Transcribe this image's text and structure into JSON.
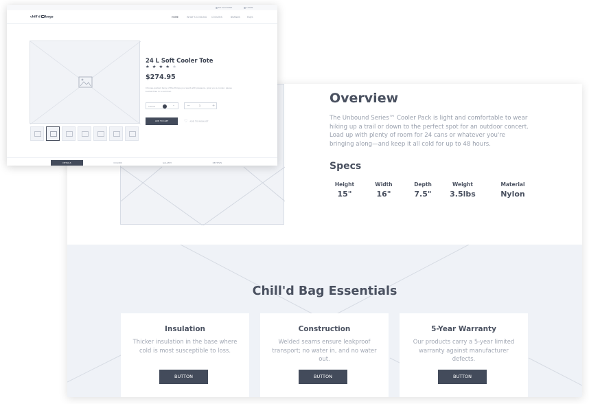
{
  "front": {
    "utility": {
      "account": "MY ACCOUNT",
      "login": "LOGIN"
    },
    "logo": {
      "left": "chill'd",
      "right": "bags"
    },
    "nav": [
      "HOME",
      "WHAT'S COOLING",
      "COOLERS",
      "BRANDS",
      "FAQS"
    ],
    "product": {
      "title": "24 L Soft Cooler Tote",
      "rating": 4,
      "stars_filled": "★ ★ ★ ★",
      "stars_empty": "★",
      "price": "$274.95",
      "description": "Choose-packed bevy of the things you want with pleasure, give you a cooler, pause bucket-free in a summer.",
      "color_label": "COLOR",
      "qty_minus": "−",
      "qty_value": "1",
      "qty_plus": "+",
      "add_to_cart": "ADD TO CART",
      "wishlist": "ADD TO WISHLIST"
    },
    "tabs": [
      "DETAILS",
      "COLORS",
      "GALLERY",
      "REVIEWS"
    ]
  },
  "overview": {
    "title": "Overview",
    "text": "The Unbound Series™ Cooler Pack is light and comfortable to wear hiking up a trail or down to the perfect spot for an outdoor concert. Load up with plenty of room for 24 cans or whatever you're bringing along—and keep it all cold for up to 48 hours."
  },
  "specs": {
    "title": "Specs",
    "items": [
      {
        "label": "Height",
        "value": "15\""
      },
      {
        "label": "Width",
        "value": "16\""
      },
      {
        "label": "Depth",
        "value": "7.5\""
      },
      {
        "label": "Weight",
        "value": "3.5lbs"
      },
      {
        "label": "Material",
        "value": "Nylon"
      }
    ]
  },
  "essentials": {
    "title": "Chill'd Bag Essentials",
    "cards": [
      {
        "title": "Insulation",
        "text": "Thicker insulation in the base where cold is most susceptible to loss.",
        "button": "BUTTON"
      },
      {
        "title": "Construction",
        "text": "Welded seams ensure leakproof transport; no water in, and no water out.",
        "button": "BUTTON"
      },
      {
        "title": "5-Year Warranty",
        "text": "Our products carry a 5-year limited warranty against manufacturer defects.",
        "button": "BUTTON"
      }
    ]
  },
  "colors": {
    "dark": "#434b5b",
    "placeholder_bg": "#f1f3f7",
    "section_bg": "#eff2f7",
    "muted_text": "#9aa1ae"
  },
  "icons": {
    "placeholder": "image-placeholder-icon",
    "heart": "heart-icon"
  }
}
